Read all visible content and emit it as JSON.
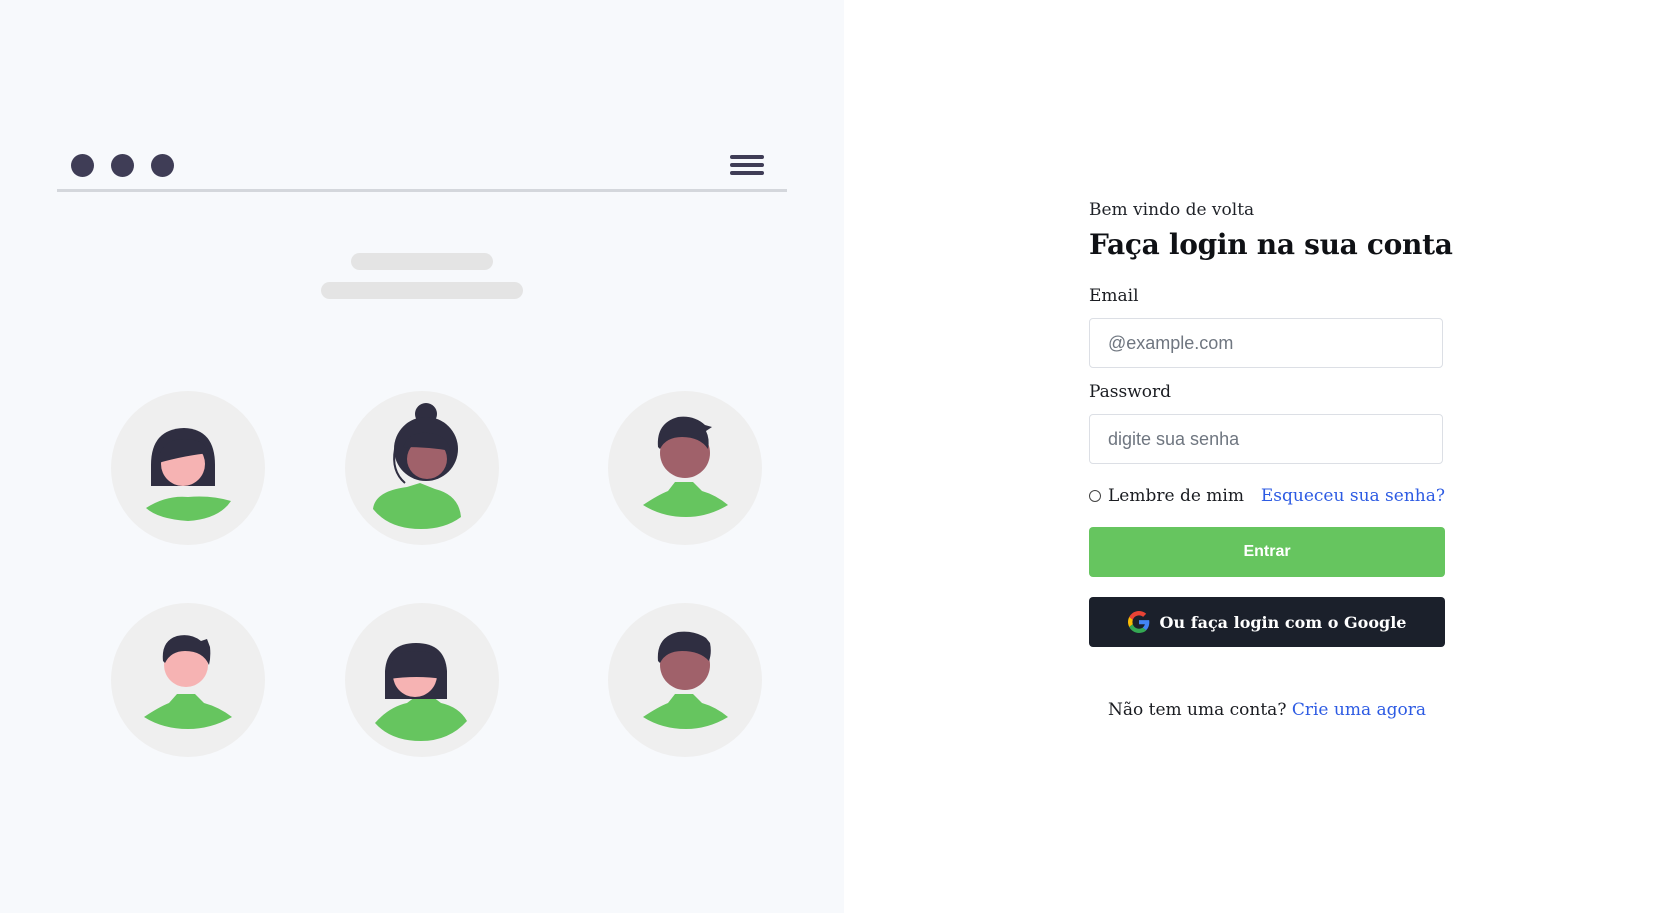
{
  "illustration": {
    "window_dots": 3,
    "menu_icon": "hamburger-icon",
    "avatars": [
      {
        "name": "avatar-woman-bob",
        "shirt_color": "#66c55f",
        "skin_color": "#f6b3b3"
      },
      {
        "name": "avatar-woman-bun",
        "shirt_color": "#66c55f",
        "skin_color": "#a0616a"
      },
      {
        "name": "avatar-man-dark",
        "shirt_color": "#66c55f",
        "skin_color": "#a0616a"
      },
      {
        "name": "avatar-man-light",
        "shirt_color": "#66c55f",
        "skin_color": "#f6b3b3"
      },
      {
        "name": "avatar-woman-bangs",
        "shirt_color": "#66c55f",
        "skin_color": "#f6b3b3"
      },
      {
        "name": "avatar-man-dark-2",
        "shirt_color": "#66c55f",
        "skin_color": "#a0616a"
      }
    ]
  },
  "form": {
    "welcome": "Bem vindo de volta",
    "title": "Faça login na sua conta",
    "email_label": "Email",
    "email_placeholder": "@example.com",
    "password_label": "Password",
    "password_placeholder": "digite sua senha",
    "remember_label": "Lembre de mim",
    "forgot_link": "Esqueceu sua senha?",
    "login_button": "Entrar",
    "google_button": "Ou faça login com o Google",
    "signup_text": "Não tem uma conta?",
    "signup_link": "Crie uma agora"
  },
  "colors": {
    "accent_green": "#66c55f",
    "dark_button": "#1b202b",
    "link_blue": "#2d5be3",
    "illustration_dark": "#3f3d56"
  }
}
